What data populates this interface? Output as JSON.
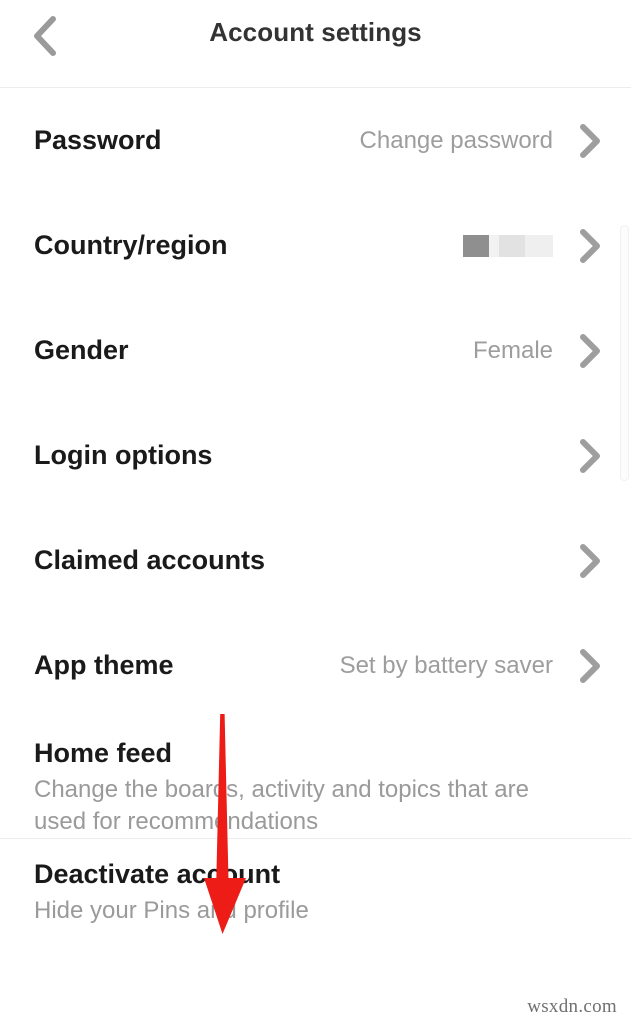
{
  "header": {
    "back_icon": "chevron-left-icon",
    "title": "Account settings"
  },
  "settings": {
    "rows": [
      {
        "label": "Password",
        "value": "Change password",
        "chevron": "chevron-right-icon"
      },
      {
        "label": "Country/region",
        "value": "",
        "value_redacted": true,
        "chevron": "chevron-right-icon"
      },
      {
        "label": "Gender",
        "value": "Female",
        "chevron": "chevron-right-icon"
      },
      {
        "label": "Login options",
        "value": "",
        "chevron": "chevron-right-icon"
      },
      {
        "label": "Claimed accounts",
        "value": "",
        "chevron": "chevron-right-icon"
      },
      {
        "label": "App theme",
        "value": "Set by battery saver",
        "chevron": "chevron-right-icon"
      },
      {
        "label": "Home feed",
        "subtitle": "Change the boards, activity and topics that are used for recommendations",
        "value": "",
        "chevron": ""
      }
    ]
  },
  "danger_section": {
    "rows": [
      {
        "label": "Deactivate account",
        "subtitle": "Hide your Pins and profile"
      }
    ]
  },
  "annotation": {
    "type": "down-arrow",
    "color": "#ED1C16"
  },
  "watermark": {
    "text": "wsxdn.com"
  },
  "colors": {
    "background": "#ffffff",
    "label": "#1a1a1a",
    "muted": "#9d9d9d",
    "divider": "#ececec",
    "chevron": "#9e9e9e",
    "annotation": "#ED1C16"
  }
}
